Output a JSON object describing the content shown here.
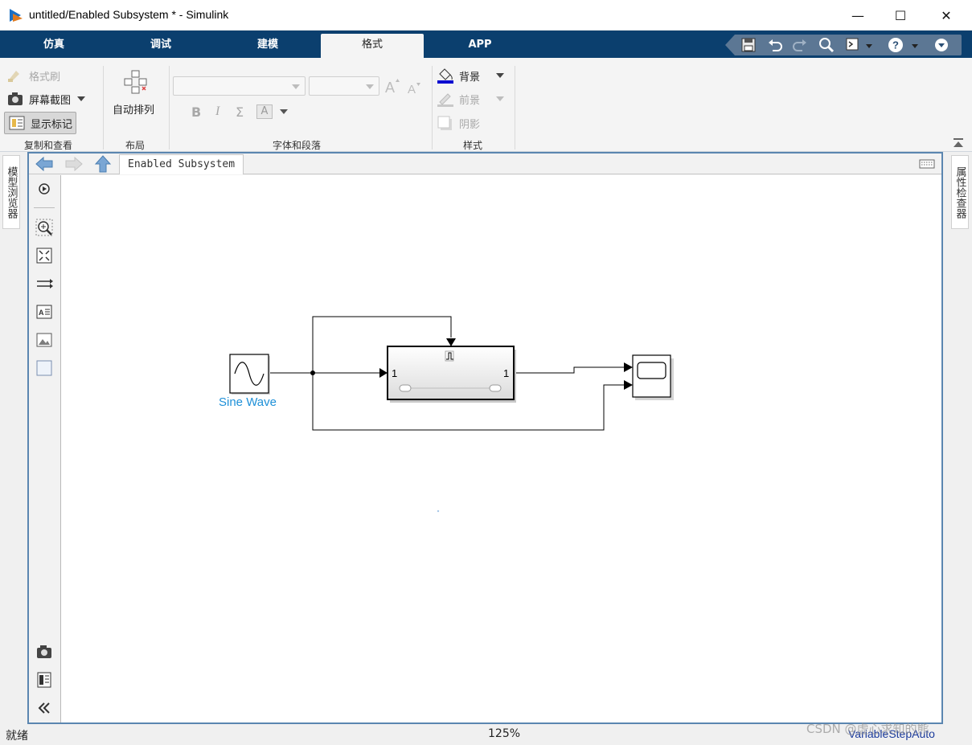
{
  "window": {
    "title": "untitled/Enabled Subsystem * - Simulink",
    "controls": {
      "minimize": "—",
      "maximize": "☐",
      "close": "✕"
    }
  },
  "tabs": [
    {
      "label": "仿真",
      "active": false
    },
    {
      "label": "调试",
      "active": false
    },
    {
      "label": "建模",
      "active": false
    },
    {
      "label": "格式",
      "active": true
    },
    {
      "label": "APP",
      "active": false
    }
  ],
  "ribbon": {
    "copy_view": {
      "format_painter": "格式刷",
      "screenshot": "屏幕截图",
      "show_markup": "显示标记",
      "section_label": "复制和查看"
    },
    "layout": {
      "auto_arrange": "自动排列",
      "section_label": "布局"
    },
    "font": {
      "section_label": "字体和段落",
      "bold": "B",
      "italic": "I",
      "sigma": "Σ",
      "text_a": "A"
    },
    "style": {
      "background": "背景",
      "foreground": "前景",
      "shadow": "阴影",
      "section_label": "样式"
    }
  },
  "side_panels": {
    "left": "模型浏览器",
    "right": "属性检查器"
  },
  "breadcrumb": "Enabled Subsystem",
  "model": {
    "sine_label": "Sine Wave",
    "subsystem_in_port": "1",
    "subsystem_out_port": "1"
  },
  "status": {
    "left": "就绪",
    "zoom": "125%",
    "solver": "VariableStepAuto",
    "watermark": "CSDN @虚心求知的熊"
  },
  "colors": {
    "tabstrip": "#0b3f6e",
    "sine_label": "#1e90d8",
    "solver": "#1a3a9c",
    "editor_border": "#5b86b0"
  }
}
